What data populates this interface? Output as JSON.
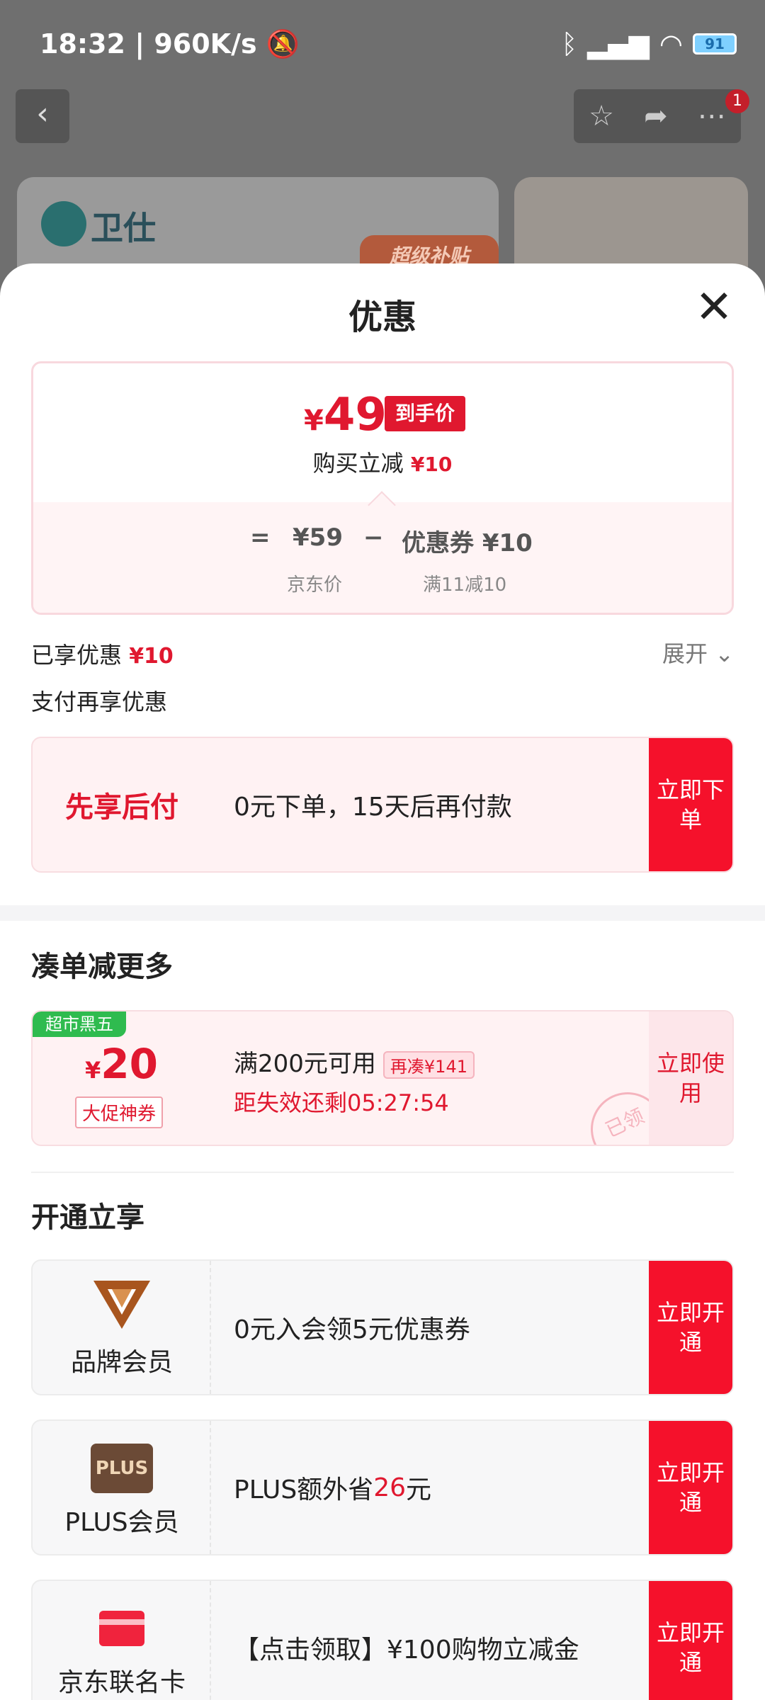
{
  "status_bar": {
    "time": "18:32",
    "speed": "960K/s",
    "battery": "91"
  },
  "background": {
    "brand": "卫仕",
    "banner_tag": "超级补贴"
  },
  "sheet": {
    "title": "优惠",
    "price_card": {
      "final_price_symbol": "¥",
      "final_price": "49",
      "final_tag": "到手价",
      "reduce_label": "购买立减",
      "reduce_amount": "¥10",
      "eq": "=",
      "jd_price": "¥59",
      "minus": "−",
      "coupon": "优惠券 ¥10",
      "jd_price_label": "京东价",
      "coupon_rule": "满11减10"
    },
    "enjoyed_label": "已享优惠",
    "enjoyed_amount": "¥10",
    "expand_label": "展开",
    "pay_more_label": "支付再享优惠",
    "bnpl": {
      "label": "先享后付",
      "desc": "0元下单，15天后再付款",
      "action": "立即下单"
    },
    "section_more": "凑单减更多",
    "coupon": {
      "badge": "超市黑五",
      "symbol": "¥",
      "amount": "20",
      "type": "大促神券",
      "rule": "满200元可用",
      "tag": "再凑¥141",
      "timer": "距失效还剩05:27:54",
      "action": "立即使用",
      "stamp": "已领"
    },
    "section_open": "开通立享",
    "brand_member": {
      "label": "品牌会员",
      "desc": "0元入会领5元优惠券",
      "action": "立即开通"
    },
    "plus_member": {
      "logo": "PLUS",
      "label": "PLUS会员",
      "desc_prefix": "PLUS额外省",
      "desc_amount": "26",
      "desc_suffix": "元",
      "action": "立即开通"
    },
    "jd_card": {
      "label": "京东联名卡",
      "desc": "【点击领取】¥100购物立减金",
      "action": "立即开通"
    }
  }
}
